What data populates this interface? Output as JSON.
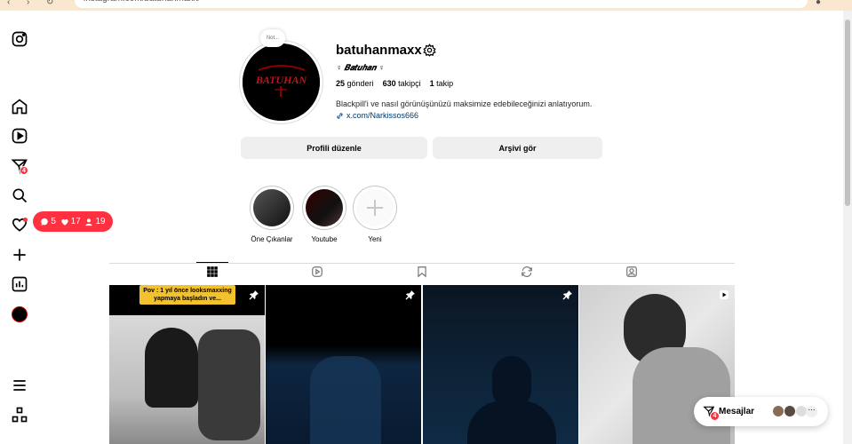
{
  "browser": {
    "url": "instagram.com/batuhanmaxx/"
  },
  "sidebar": {
    "messages_badge": "4",
    "notifications": {
      "comments": "5",
      "likes": "17",
      "follows": "19"
    }
  },
  "profile": {
    "username": "batuhanmaxx",
    "display_name": "♀ 𝑩𝒂𝒕𝒖𝒉𝒂𝒏 ♀",
    "avatar_text": "BATUHAN",
    "note": "Not...",
    "stats": {
      "posts_count": "25",
      "posts_label": "gönderi",
      "followers_count": "630",
      "followers_label": "takipçi",
      "following_count": "1",
      "following_label": "takip"
    },
    "bio": "Blackpill'i ve nasıl görünüşünüzü maksimize edebileceğinizi anlatıyorum.",
    "link": "x.com/Narkissos666"
  },
  "buttons": {
    "edit_profile": "Profili düzenle",
    "archive": "Arşivi gör"
  },
  "highlights": [
    {
      "label": "Öne Çıkanlar"
    },
    {
      "label": "Youtube"
    },
    {
      "label": "Yeni"
    }
  ],
  "posts": [
    {
      "caption": "Pov : 1 yıl önce looksmaxxing yapmaya başladın ve..."
    }
  ],
  "messages": {
    "label": "Mesajlar",
    "badge": "4"
  },
  "colors": {
    "accent_red": "#ff3040",
    "link_blue": "#00376b",
    "button_grey": "#efefef"
  }
}
